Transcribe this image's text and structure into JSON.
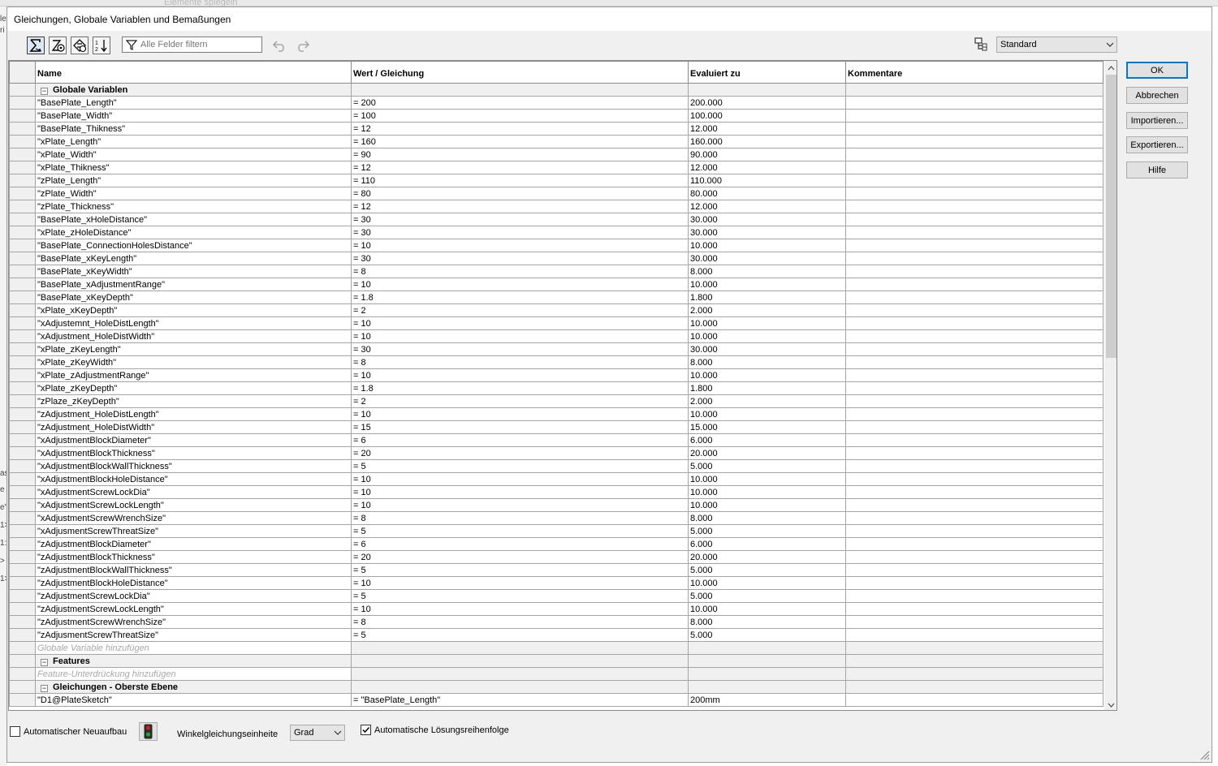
{
  "background": {
    "ghost_toolbar_text": "Elemente spiegeln",
    "left_edge_chars": [
      "le",
      "ri",
      "as",
      "e",
      "e\"",
      "1>",
      "1:",
      ">",
      "1>"
    ]
  },
  "dialog": {
    "title": "Gleichungen, Globale Variablen und Bemaßungen"
  },
  "toolbar": {
    "buttons": [
      {
        "name": "equation-view-icon",
        "glyph": "sigma"
      },
      {
        "name": "sketch-equation-view-icon",
        "glyph": "sketch"
      },
      {
        "name": "dimension-view-icon",
        "glyph": "dimension"
      },
      {
        "name": "ordered-view-icon",
        "glyph": "ordered"
      }
    ],
    "filter_placeholder": "Alle Felder filtern",
    "configuration": "Standard"
  },
  "side_buttons": {
    "ok": "OK",
    "cancel": "Abbrechen",
    "import": "Importieren...",
    "export": "Exportieren...",
    "help": "Hilfe"
  },
  "grid": {
    "columns": {
      "name": "Name",
      "value": "Wert / Gleichung",
      "evaluated": "Evaluiert zu",
      "comments": "Kommentare"
    },
    "sections": {
      "globals": {
        "title": "Globale Variablen",
        "add_hint": "Globale Variable hinzufügen",
        "rows": [
          [
            "\"BasePlate_Length\"",
            "= 200",
            "200.000"
          ],
          [
            "\"BasePlate_Width\"",
            "= 100",
            "100.000"
          ],
          [
            "\"BasePlate_Thikness\"",
            "= 12",
            "12.000"
          ],
          [
            "\"xPlate_Length\"",
            "= 160",
            "160.000"
          ],
          [
            "\"xPlate_Width\"",
            "= 90",
            "90.000"
          ],
          [
            "\"xPlate_Thikness\"",
            "= 12",
            "12.000"
          ],
          [
            "\"zPlate_Length\"",
            "= 110",
            "110.000"
          ],
          [
            "\"zPlate_Width\"",
            "= 80",
            "80.000"
          ],
          [
            "\"zPlate_Thickness\"",
            "= 12",
            "12.000"
          ],
          [
            "\"BasePlate_xHoleDistance\"",
            "= 30",
            "30.000"
          ],
          [
            "\"xPlate_zHoleDistance\"",
            "= 30",
            "30.000"
          ],
          [
            "\"BasePlate_ConnectionHolesDistance\"",
            "= 10",
            "10.000"
          ],
          [
            "\"BasePlate_xKeyLength\"",
            "= 30",
            "30.000"
          ],
          [
            "\"BasePlate_xKeyWidth\"",
            "= 8",
            "8.000"
          ],
          [
            "\"BasePlate_xAdjustmentRange\"",
            "= 10",
            "10.000"
          ],
          [
            "\"BasePlate_xKeyDepth\"",
            "= 1.8",
            "1.800"
          ],
          [
            "\"xPlate_xKeyDepth\"",
            "= 2",
            "2.000"
          ],
          [
            "\"xAdjustemnt_HoleDistLength\"",
            "= 10",
            "10.000"
          ],
          [
            "\"xAdjustment_HoleDistWidth\"",
            "= 10",
            "10.000"
          ],
          [
            "\"xPlate_zKeyLength\"",
            "= 30",
            "30.000"
          ],
          [
            "\"xPlate_zKeyWidth\"",
            "= 8",
            "8.000"
          ],
          [
            "\"xPlate_zAdjustmentRange\"",
            "= 10",
            "10.000"
          ],
          [
            "\"xPlate_zKeyDepth\"",
            "= 1.8",
            "1.800"
          ],
          [
            "\"zPlaze_zKeyDepth\"",
            "= 2",
            "2.000"
          ],
          [
            "\"zAdjustment_HoleDistLength\"",
            "= 10",
            "10.000"
          ],
          [
            "\"zAdjustment_HoleDistWidth\"",
            "= 15",
            "15.000"
          ],
          [
            "\"xAdjustmentBlockDiameter\"",
            "= 6",
            "6.000"
          ],
          [
            "\"xAdjustmentBlockThickness\"",
            "= 20",
            "20.000"
          ],
          [
            "\"xAdjustmentBlockWallThickness\"",
            "= 5",
            "5.000"
          ],
          [
            "\"xAdjustmentBlockHoleDistance\"",
            "= 10",
            "10.000"
          ],
          [
            "\"xAdjustmentScrewLockDia\"",
            "= 10",
            "10.000"
          ],
          [
            "\"xAdjustmentScrewLockLength\"",
            "= 10",
            "10.000"
          ],
          [
            "\"xAdjustmentScrewWrenchSize\"",
            "= 8",
            "8.000"
          ],
          [
            "\"xAdjusmentScrewThreatSize\"",
            "= 5",
            "5.000"
          ],
          [
            "\"zAdjustmentBlockDiameter\"",
            "= 6",
            "6.000"
          ],
          [
            "\"zAdjustmentBlockThickness\"",
            "= 20",
            "20.000"
          ],
          [
            "\"zAdjustmentBlockWallThickness\"",
            "= 5",
            "5.000"
          ],
          [
            "\"zAdjustmentBlockHoleDistance\"",
            "= 10",
            "10.000"
          ],
          [
            "\"zAdjustmentScrewLockDia\"",
            "= 5",
            "5.000"
          ],
          [
            "\"zAdjustmentScrewLockLength\"",
            "= 10",
            "10.000"
          ],
          [
            "\"zAdjustmentScrewWrenchSize\"",
            "= 8",
            "8.000"
          ],
          [
            "\"zAdjusmentScrewThreatSize\"",
            "= 5",
            "5.000"
          ]
        ]
      },
      "features": {
        "title": "Features",
        "add_hint": "Feature-Unterdrückung hinzufügen"
      },
      "top_level": {
        "title": "Gleichungen - Oberste Ebene",
        "rows": [
          [
            "\"D1@PlateSketch\"",
            "= \"BasePlate_Length\"",
            "200mm"
          ]
        ]
      }
    }
  },
  "bottom": {
    "auto_rebuild_label": "Automatischer Neuaufbau",
    "auto_rebuild_checked": false,
    "angle_unit_label": "Winkelgleichungseinheite",
    "angle_unit_value": "Grad",
    "auto_solve_label": "Automatische Lösungsreihenfolge",
    "auto_solve_checked": true
  }
}
